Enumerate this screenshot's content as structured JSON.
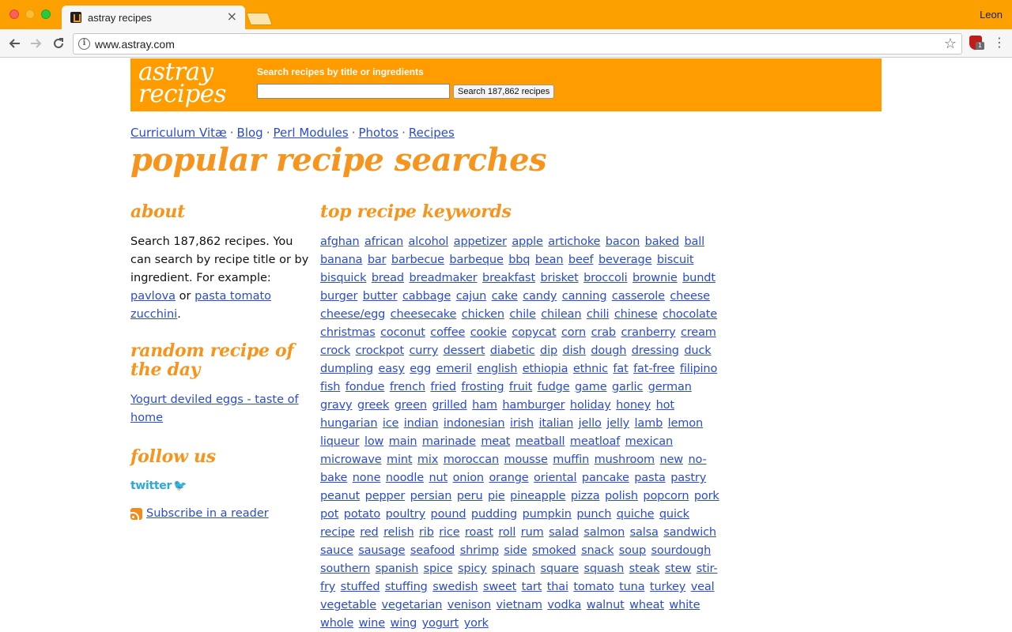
{
  "browser": {
    "tab_title": "astray recipes",
    "tab_close": "×",
    "profile_name": "Leon",
    "url": "www.astray.com",
    "ext_badge": "1"
  },
  "banner": {
    "logo_line1": "astray",
    "logo_line2": "recipes",
    "search_label": "Search recipes by title or ingredients",
    "search_value": "",
    "search_button": "Search 187,862 recipes"
  },
  "topnav": [
    {
      "label": "Curriculum Vitæ"
    },
    {
      "label": "Blog"
    },
    {
      "label": "Perl Modules"
    },
    {
      "label": "Photos"
    },
    {
      "label": "Recipes"
    }
  ],
  "page_title": "popular recipe searches",
  "sidebar": {
    "about_heading": "about",
    "about_text_1": "Search 187,862 recipes. You can search by recipe title or by ingredient. For example: ",
    "about_example_1": "pavlova",
    "about_text_2": " or ",
    "about_example_2": "pasta tomato zucchini",
    "about_text_3": ".",
    "random_heading": "random recipe of the day",
    "random_link": "Yogurt deviled eggs - taste of home",
    "follow_heading": "follow us",
    "twitter_label": "twitter",
    "subscribe_link": "Subscribe in a reader"
  },
  "keywords": {
    "heading": "top recipe keywords",
    "items": [
      "afghan",
      "african",
      "alcohol",
      "appetizer",
      "apple",
      "artichoke",
      "bacon",
      "baked",
      "ball",
      "banana",
      "bar",
      "barbecue",
      "barbeque",
      "bbq",
      "bean",
      "beef",
      "beverage",
      "biscuit",
      "bisquick",
      "bread",
      "breadmaker",
      "breakfast",
      "brisket",
      "broccoli",
      "brownie",
      "bundt",
      "burger",
      "butter",
      "cabbage",
      "cajun",
      "cake",
      "candy",
      "canning",
      "casserole",
      "cheese",
      "cheese/egg",
      "cheesecake",
      "chicken",
      "chile",
      "chilean",
      "chili",
      "chinese",
      "chocolate",
      "christmas",
      "coconut",
      "coffee",
      "cookie",
      "copycat",
      "corn",
      "crab",
      "cranberry",
      "cream",
      "crock",
      "crockpot",
      "curry",
      "dessert",
      "diabetic",
      "dip",
      "dish",
      "dough",
      "dressing",
      "duck",
      "dumpling",
      "easy",
      "egg",
      "emeril",
      "english",
      "ethiopia",
      "ethnic",
      "fat",
      "fat-free",
      "filipino",
      "fish",
      "fondue",
      "french",
      "fried",
      "frosting",
      "fruit",
      "fudge",
      "game",
      "garlic",
      "german",
      "gravy",
      "greek",
      "green",
      "grilled",
      "ham",
      "hamburger",
      "holiday",
      "honey",
      "hot",
      "hungarian",
      "ice",
      "indian",
      "indonesian",
      "irish",
      "italian",
      "jello",
      "jelly",
      "lamb",
      "lemon",
      "liqueur",
      "low",
      "main",
      "marinade",
      "meat",
      "meatball",
      "meatloaf",
      "mexican",
      "microwave",
      "mint",
      "mix",
      "moroccan",
      "mousse",
      "muffin",
      "mushroom",
      "new",
      "no-bake",
      "none",
      "noodle",
      "nut",
      "onion",
      "orange",
      "oriental",
      "pancake",
      "pasta",
      "pastry",
      "peanut",
      "pepper",
      "persian",
      "peru",
      "pie",
      "pineapple",
      "pizza",
      "polish",
      "popcorn",
      "pork",
      "pot",
      "potato",
      "poultry",
      "pound",
      "pudding",
      "pumpkin",
      "punch",
      "quiche",
      "quick",
      "recipe",
      "red",
      "relish",
      "rib",
      "rice",
      "roast",
      "roll",
      "rum",
      "salad",
      "salmon",
      "salsa",
      "sandwich",
      "sauce",
      "sausage",
      "seafood",
      "shrimp",
      "side",
      "smoked",
      "snack",
      "soup",
      "sourdough",
      "southern",
      "spanish",
      "spice",
      "spicy",
      "spinach",
      "square",
      "squash",
      "steak",
      "stew",
      "stir-fry",
      "stuffed",
      "stuffing",
      "swedish",
      "sweet",
      "tart",
      "thai",
      "tomato",
      "tuna",
      "turkey",
      "veal",
      "vegetable",
      "vegetarian",
      "venison",
      "vietnam",
      "vodka",
      "walnut",
      "wheat",
      "white",
      "whole",
      "wine",
      "wing",
      "yogurt",
      "york"
    ]
  },
  "colors": {
    "brand_orange": "#ff9c00",
    "heading_orange": "#f7941d",
    "link_blue": "#2a4bd6",
    "twitter_blue": "#2aa9e0"
  }
}
